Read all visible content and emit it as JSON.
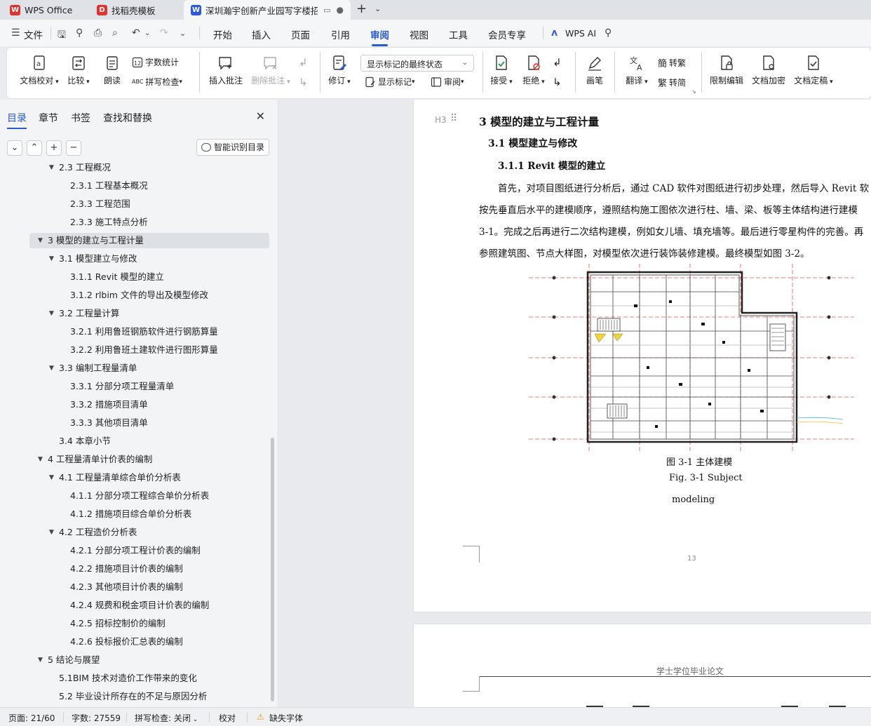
{
  "tabs": [
    {
      "label": "WPS Office",
      "logo": "W",
      "color": "#e0322f"
    },
    {
      "label": "找稻壳模板",
      "logo": "D",
      "color": "#e0322f"
    },
    {
      "label": "深圳瀚宇创新产业园写字楼招标",
      "logo": "W",
      "color": "#2b5ae0"
    }
  ],
  "menu": {
    "file": "文件",
    "items": [
      "开始",
      "插入",
      "页面",
      "引用",
      "审阅",
      "视图",
      "工具",
      "会员专享"
    ],
    "active": "审阅",
    "ai": "WPS AI"
  },
  "ribbon": {
    "doc_proof": "文档校对",
    "compare": "比较",
    "read_aloud": "朗读",
    "word_count": "字数统计",
    "spell_check": "拼写检查",
    "insert_comment": "插入批注",
    "delete_comment": "删除批注",
    "revise": "修订",
    "display_state": "显示标记的最终状态",
    "show_markup": "显示标记",
    "review": "审阅",
    "accept": "接受",
    "reject": "拒绝",
    "pen": "画笔",
    "translate": "翻译",
    "to_traditional": "转繁",
    "to_simplified": "转简",
    "restrict_edit": "限制编辑",
    "doc_encrypt": "文档加密",
    "doc_finalize": "文档定稿"
  },
  "nav": {
    "tabs": [
      "目录",
      "章节",
      "书签",
      "查找和替换"
    ],
    "smart_toc": "智能识别目录",
    "items": [
      {
        "label": "2.3 工程概况",
        "level": 2,
        "arrow": "▾"
      },
      {
        "label": "2.3.1 工程基本概况",
        "level": 3
      },
      {
        "label": "2.3.3 工程范围",
        "level": 3
      },
      {
        "label": "2.3.3 施工特点分析",
        "level": 3
      },
      {
        "label": "3 模型的建立与工程计量",
        "level": 1,
        "arrow": "▾",
        "selected": true
      },
      {
        "label": "3.1 模型建立与修改",
        "level": 2,
        "arrow": "▾"
      },
      {
        "label": "3.1.1 Revit  模型的建立",
        "level": 3
      },
      {
        "label": "3.1.2 rlbim 文件的导出及模型修改",
        "level": 3
      },
      {
        "label": "3.2 工程量计算",
        "level": 2,
        "arrow": "▾"
      },
      {
        "label": "3.2.1 利用鲁班钢筋软件进行钢筋算量",
        "level": 3
      },
      {
        "label": "3.2.2 利用鲁班土建软件进行图形算量",
        "level": 3
      },
      {
        "label": "3.3 编制工程量清单",
        "level": 2,
        "arrow": "▾"
      },
      {
        "label": "3.3.1 分部分项工程量清单",
        "level": 3
      },
      {
        "label": "3.3.2 措施项目清单",
        "level": 3
      },
      {
        "label": "3.3.3 其他项目清单",
        "level": 3
      },
      {
        "label": "3.4 本章小节",
        "level": 2
      },
      {
        "label": "4 工程量清单计价表的编制",
        "level": 1,
        "arrow": "▾"
      },
      {
        "label": "4.1 工程量清单综合单价分析表",
        "level": 2,
        "arrow": "▾"
      },
      {
        "label": "4.1.1 分部分项工程综合单价分析表",
        "level": 3
      },
      {
        "label": "4.1.2 措施项目综合单价分析表",
        "level": 3
      },
      {
        "label": "4.2 工程造价分析表",
        "level": 2,
        "arrow": "▾"
      },
      {
        "label": "4.2.1 分部分项工程计价表的编制",
        "level": 3
      },
      {
        "label": "4.2.2 措施项目计价表的编制",
        "level": 3
      },
      {
        "label": "4.2.3 其他项目计价表的编制",
        "level": 3
      },
      {
        "label": "4.2.4 规费和税金项目计价表的编制",
        "level": 3
      },
      {
        "label": "4.2.5 招标控制价的编制",
        "level": 3
      },
      {
        "label": "4.2.6 投标报价汇总表的编制",
        "level": 3
      },
      {
        "label": "5 结论与展望",
        "level": 1,
        "arrow": "▾"
      },
      {
        "label": "5.1BIM 技术对造价工作带来的变化",
        "level": 2
      },
      {
        "label": "5.2 毕业设计所存在的不足与原因分析",
        "level": 2
      }
    ]
  },
  "document": {
    "heading_marker": "H3",
    "h1": "3 模型的建立与工程计量",
    "h2": "3.1 模型建立与修改",
    "h3": "3.1.1 Revit  模型的建立",
    "paragraph": [
      "首先，对项目图纸进行分析后，通过  CAD  软件对图纸进行初步处理，然后导入  Revit  软",
      "按先垂直后水平的建模顺序，遵照结构施工图依次进行柱、墙、梁、板等主体结构进行建模",
      "3-1。完成之后再进行二次结构建模，例如女儿墙、填充墙等。最后进行零星构件的完善。再",
      "参照建筑图、节点大样图，对模型依次进行装饰装修建模。最终模型如图 3-2。"
    ],
    "figure_caption_cn": "图 3-1  主体建模",
    "figure_caption_en_1": "Fig. 3-1 Subject",
    "figure_caption_en_2": "modeling",
    "page_number": "13",
    "next_page_header": "学士学位毕业论文"
  },
  "status": {
    "page": "页面: 21/60",
    "words": "字数: 27559",
    "spell": "拼写检查: 关闭",
    "proof": "校对",
    "missing_font": "缺失字体"
  }
}
